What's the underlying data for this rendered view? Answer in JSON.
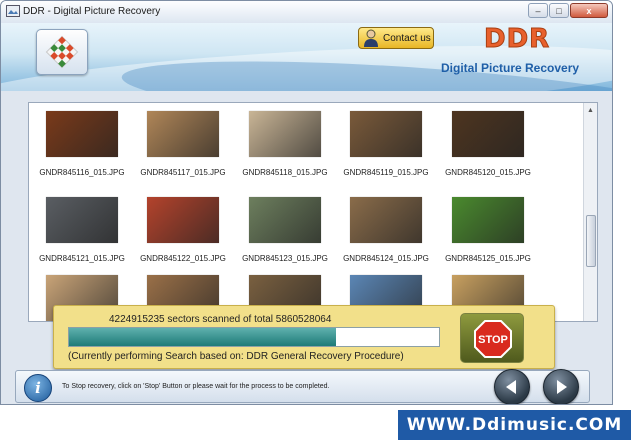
{
  "window": {
    "title": "DDR - Digital Picture Recovery",
    "minimize_glyph": "–",
    "maximize_glyph": "□",
    "close_glyph": "x"
  },
  "header": {
    "contact_label": "Contact us",
    "brand": "DDR",
    "subtitle": "Digital Picture Recovery",
    "brand_color": "#e8602c",
    "subtitle_color": "#1f5fa8"
  },
  "gallery": {
    "items": [
      {
        "name": "GNDR845116_015.JPG",
        "color": "#7a3a1a"
      },
      {
        "name": "GNDR845117_015.JPG",
        "color": "#b08658"
      },
      {
        "name": "GNDR845118_015.JPG",
        "color": "#c9b596"
      },
      {
        "name": "GNDR845119_015.JPG",
        "color": "#7a5a3a"
      },
      {
        "name": "GNDR845120_015.JPG",
        "color": "#4e3520"
      },
      {
        "name": "GNDR845121_015.JPG",
        "color": "#5a5e63"
      },
      {
        "name": "GNDR845122_015.JPG",
        "color": "#b4432c"
      },
      {
        "name": "GNDR845123_015.JPG",
        "color": "#6d7f5e"
      },
      {
        "name": "GNDR845124_015.JPG",
        "color": "#8a6c4a"
      },
      {
        "name": "GNDR845125_015.JPG",
        "color": "#4a8a2e"
      },
      {
        "name": "",
        "color": "#c9a478"
      },
      {
        "name": "",
        "color": "#9a7048"
      },
      {
        "name": "",
        "color": "#7a6040"
      },
      {
        "name": "",
        "color": "#5b86b5"
      },
      {
        "name": "",
        "color": "#c8a060"
      }
    ]
  },
  "progress": {
    "scanned_text": "4224915235 sectors scanned of total 5860528064",
    "fraction": 0.7209,
    "mode_text": "(Currently performing Search based on:  DDR General Recovery Procedure)",
    "stop_label": "STOP",
    "panel_color": "#f2e08a",
    "fill_color": "#1d7b78"
  },
  "footer": {
    "info_glyph": "i",
    "hint": "To Stop recovery, click on 'Stop' Button or please wait for the process to be completed."
  },
  "banner": {
    "text": "WWW.Ddimusic.COM"
  }
}
